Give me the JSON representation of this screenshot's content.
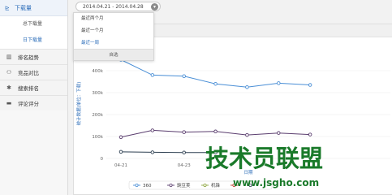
{
  "sidebar": {
    "header": {
      "label": "下载量",
      "icon": "chart-line-icon"
    },
    "sub_items": [
      {
        "label": "总下载量",
        "active": false
      },
      {
        "label": "日下载量",
        "active": true
      }
    ],
    "items": [
      {
        "label": "排名趋势",
        "icon": "bar-chart-icon"
      },
      {
        "label": "竞品对比",
        "icon": "users-icon"
      },
      {
        "label": "搜索排名",
        "icon": "search-rank-icon"
      },
      {
        "label": "评论评分",
        "icon": "comment-icon"
      }
    ]
  },
  "date_range": {
    "value": "2014.04.21 - 2014.04.28",
    "caret_icon": "chevron-down-icon"
  },
  "dropdown": {
    "options": [
      {
        "label": "最近两个月",
        "active": false
      },
      {
        "label": "最近一个月",
        "active": false
      },
      {
        "label": "最近一周",
        "active": true
      }
    ],
    "footer": "自选"
  },
  "chart_data": {
    "type": "line",
    "ylabel": "统计数据(单位：下载)",
    "xlabel": "日期",
    "ylim": [
      0,
      500000
    ],
    "yticks": [
      "0",
      "100k",
      "200k",
      "300k",
      "400k"
    ],
    "x_ticks": [
      "04-21",
      "04-23"
    ],
    "x_count": 8,
    "series": [
      {
        "name": "360",
        "color": "#4a8fd6",
        "values": [
          450000,
          380000,
          375000,
          340000,
          325000,
          343000,
          335000
        ]
      },
      {
        "name": "豌豆荚",
        "color": "#5a3d6e",
        "values": [
          97000,
          128000,
          120000,
          123000,
          107000,
          116000,
          109000
        ]
      },
      {
        "name": "机锋",
        "color": "#8aa33a",
        "values": [
          null,
          null,
          null,
          null,
          null,
          null,
          null
        ]
      },
      {
        "name": "",
        "color": "#c0392b",
        "values": [
          null,
          null,
          null,
          null,
          null,
          null,
          null
        ]
      },
      {
        "name": "",
        "color": "#2c3e50",
        "values": [
          30000,
          28000,
          27000,
          27000,
          null,
          null,
          null
        ]
      }
    ]
  },
  "watermark": {
    "main": "技术员联盟",
    "url": "www.jsgho.com"
  }
}
